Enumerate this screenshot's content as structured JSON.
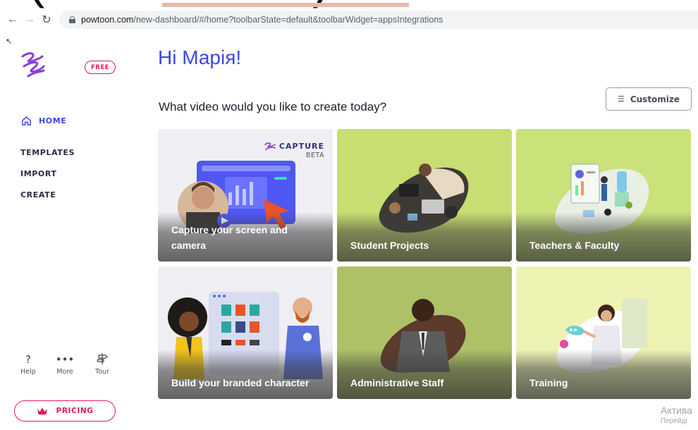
{
  "overlay": {
    "text": "(Whiteboard)"
  },
  "browser": {
    "url_host": "powtoon.com",
    "url_path": "/new-dashboard/#/home?toolbarState=default&toolbarWidget=appsIntegrations"
  },
  "sidebar": {
    "badge": "FREE",
    "home": "HOME",
    "items": [
      "TEMPLATES",
      "IMPORT",
      "CREATE"
    ],
    "tools": [
      {
        "icon": "help-icon",
        "label": "Help"
      },
      {
        "icon": "more-icon",
        "label": "More"
      },
      {
        "icon": "signpost-icon",
        "label": "Tour"
      }
    ],
    "pricing": "PRICING"
  },
  "main": {
    "greeting": "Hi Марія!",
    "question": "What video would you like to create today?",
    "customize": "Customize",
    "capture_badge": {
      "name": "CAPTURE",
      "tag": "BETA"
    },
    "cards": [
      {
        "title": "Capture your screen and camera",
        "bg": "#eeeef3"
      },
      {
        "title": "Student Projects",
        "bg": "#c8dd72"
      },
      {
        "title": "Teachers & Faculty",
        "bg": "#c9e27a"
      },
      {
        "title": "Build your branded character",
        "bg": "#eeeef3"
      },
      {
        "title": "Administrative Staff",
        "bg": "#aec167"
      },
      {
        "title": "Training",
        "bg": "#eef3b4"
      }
    ]
  },
  "watermark": {
    "line1": "Актива",
    "line2": "Перейді"
  },
  "colors": {
    "brand_blue": "#3b47e6",
    "brand_pink": "#e5195a"
  }
}
